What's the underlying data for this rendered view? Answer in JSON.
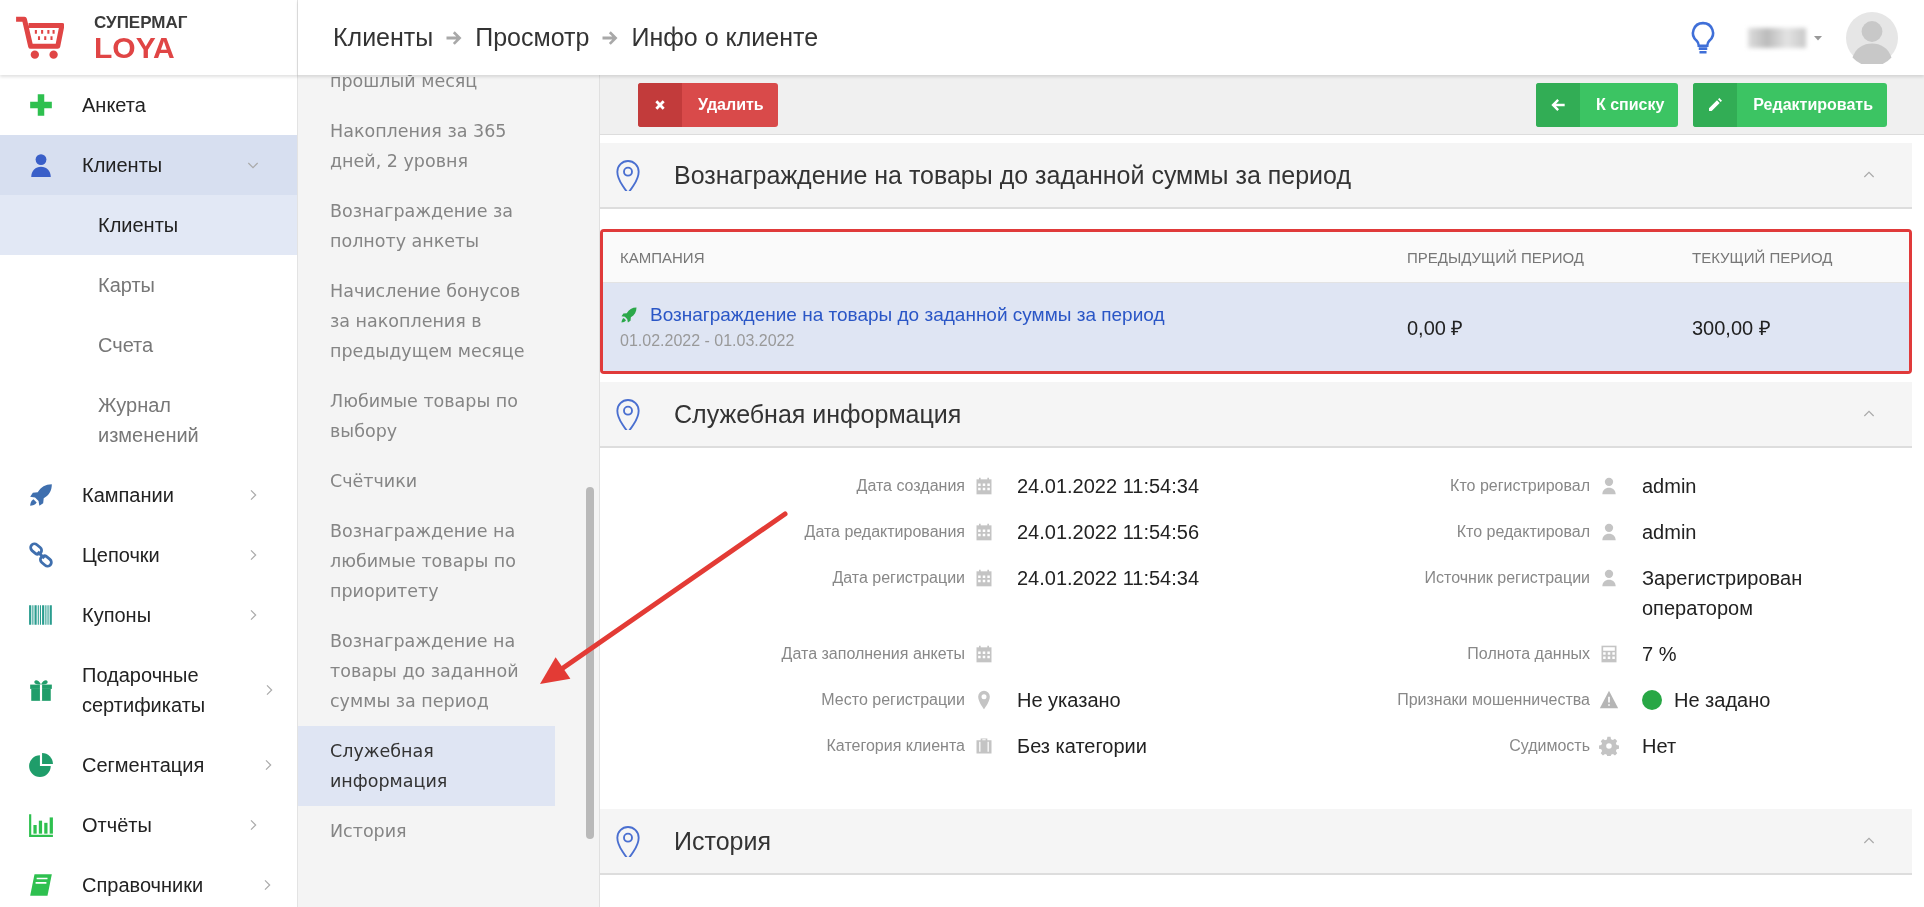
{
  "logo": {
    "title": "СУПЕРМАГ",
    "subtitle": "LOYA"
  },
  "breadcrumbs": [
    "Клиенты",
    "Просмотр",
    "Инфо о клиенте"
  ],
  "sidebar": {
    "items": [
      {
        "label": "Анкета",
        "selected": false
      },
      {
        "label": "Клиенты",
        "selected": true,
        "expanded": true,
        "children": [
          {
            "label": "Клиенты",
            "selected": true
          },
          {
            "label": "Карты",
            "selected": false
          },
          {
            "label": "Счета",
            "selected": false
          },
          {
            "label": "Журнал изменений",
            "selected": false
          }
        ]
      },
      {
        "label": "Кампании",
        "selected": false,
        "expanded": false
      },
      {
        "label": "Цепочки",
        "selected": false,
        "expanded": false
      },
      {
        "label": "Купоны",
        "selected": false,
        "expanded": false
      },
      {
        "label": "Подарочные сертификаты",
        "selected": false,
        "expanded": false
      },
      {
        "label": "Сегментация",
        "selected": false,
        "expanded": false
      },
      {
        "label": "Отчёты",
        "selected": false,
        "expanded": false
      },
      {
        "label": "Справочники",
        "selected": false,
        "expanded": false
      }
    ]
  },
  "section_nav": {
    "items": [
      {
        "label": "прошлый месяц",
        "selected": false
      },
      {
        "label": "Накопления за 365 дней, 2 уровня",
        "selected": false
      },
      {
        "label": "Вознаграждение за полноту анкеты",
        "selected": false
      },
      {
        "label": "Начисление бонусов за накопления в предыдущем месяце",
        "selected": false
      },
      {
        "label": "Любимые товары по выбору",
        "selected": false
      },
      {
        "label": "Счётчики",
        "selected": false
      },
      {
        "label": "Вознаграждение на любимые товары по приоритету",
        "selected": false
      },
      {
        "label": "Вознаграждение на товары до заданной суммы за период",
        "selected": false
      },
      {
        "label": "Служебная информация",
        "selected": true
      },
      {
        "label": "История",
        "selected": false
      }
    ]
  },
  "toolbar": {
    "buttons": [
      {
        "label": "Удалить",
        "kind": "danger"
      },
      {
        "label": "К списку",
        "kind": "success"
      },
      {
        "label": "Редактировать",
        "kind": "success"
      }
    ]
  },
  "sections": [
    {
      "title": "Вознаграждение на товары до заданной суммы за период",
      "expanded": true,
      "kind": "table",
      "table": {
        "columns": [
          "КАМПАНИЯ",
          "ПРЕДЫДУЩИЙ ПЕРИОД",
          "ТЕКУЩИЙ ПЕРИОД"
        ],
        "rows": [
          {
            "campaign": "Вознаграждение на товары до заданной суммы за период",
            "period": "01.02.2022 - 01.03.2022",
            "previous": "0,00 ₽",
            "current": "300,00 ₽"
          }
        ]
      }
    },
    {
      "title": "Служебная информация",
      "expanded": true,
      "kind": "fields",
      "rows": [
        {
          "left": {
            "label": "Дата создания",
            "value": "24.01.2022 11:54:34"
          },
          "right": {
            "label": "Кто регистрировал",
            "value": "admin"
          }
        },
        {
          "left": {
            "label": "Дата редактирования",
            "value": "24.01.2022 11:54:56"
          },
          "right": {
            "label": "Кто редактировал",
            "value": "admin"
          }
        },
        {
          "left": {
            "label": "Дата регистрации",
            "value": "24.01.2022 11:54:34"
          },
          "right": {
            "label": "Источник регистрации",
            "value": "Зарегистрирован оператором"
          }
        },
        {
          "left": {
            "label": "Дата заполнения анкеты"
          },
          "right": {
            "label": "Полнота данных",
            "value": "7 %"
          }
        },
        {
          "left": {
            "label": "Место регистрации",
            "value": "Не указано"
          },
          "right": {
            "label": "Признаки мошенничества",
            "value": "Не задано",
            "color": "#28a745"
          }
        },
        {
          "left": {
            "label": "Категория клиента",
            "value": "Без категории"
          },
          "right": {
            "label": "Судимость",
            "value": "Нет"
          }
        }
      ]
    },
    {
      "title": "История",
      "expanded": true,
      "kind": "empty"
    }
  ]
}
